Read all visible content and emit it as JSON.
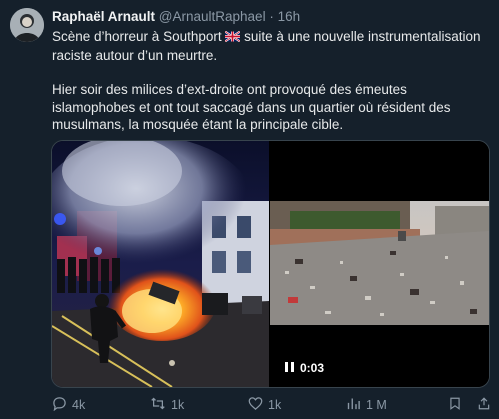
{
  "author": {
    "name": "Raphaël Arnault",
    "handle": "@ArnaultRaphael",
    "separator": "·",
    "time": "16h"
  },
  "tweet": {
    "line1_before_flag": "Scène d’horreur à Southport ",
    "flag_icon": "uk-flag-icon",
    "line1_after_flag": " suite à une nouvelle instrumentalisation raciste autour d’un meurtre.",
    "paragraph2": "Hier soir des milices d’ext-droite ont provoqué des émeutes islamophobes et ont tout saccagé dans un quartier où résident des musulmans, la mosquée étant la principale cible."
  },
  "video": {
    "duration": "0:03"
  },
  "actions": {
    "replies": "4k",
    "reposts": "1k",
    "likes": "1k",
    "views": "1 M"
  },
  "colors": {
    "background": "#15202b",
    "text": "#e7e9ea",
    "muted": "#8b98a5",
    "border": "#38444d"
  }
}
